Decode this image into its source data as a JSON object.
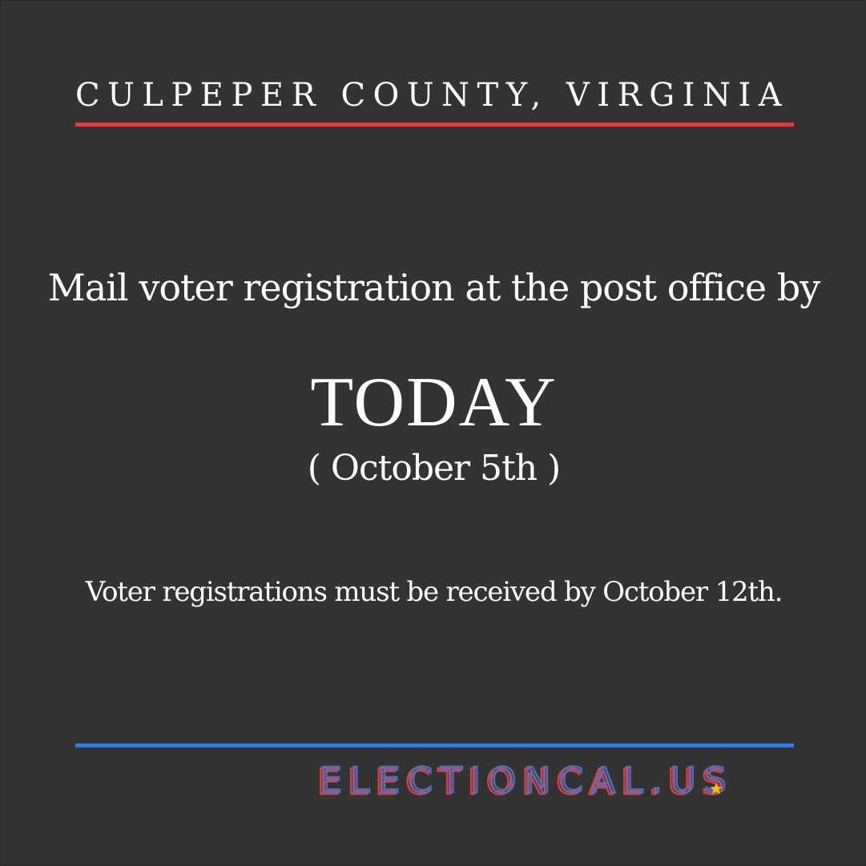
{
  "header": {
    "county": "CULPEPER COUNTY, VIRGINIA"
  },
  "main": {
    "headline": "Mail voter registration at the post office by",
    "deadline": "TODAY",
    "date": "( October 5th )",
    "note": "Voter registrations must be received by October 12th."
  },
  "footer": {
    "brand": "ELECTIONCAL.US"
  },
  "colors": {
    "background": "#333333",
    "text": "#ffffff",
    "accent_red": "#e8393a",
    "accent_blue": "#2d7be3",
    "logo_star": "#f2c200"
  }
}
